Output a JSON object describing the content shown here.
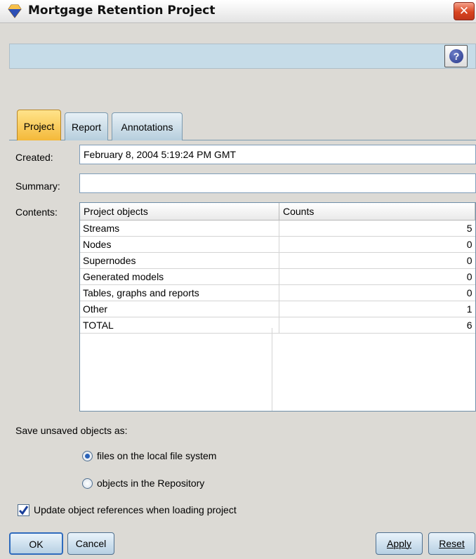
{
  "window": {
    "title": "Mortgage Retention Project",
    "close_glyph": "✕",
    "help_glyph": "?"
  },
  "tabs": [
    {
      "label": "Project",
      "active": true
    },
    {
      "label": "Report",
      "active": false
    },
    {
      "label": "Annotations",
      "active": false
    }
  ],
  "form": {
    "created_label": "Created:",
    "created_value": "February 8, 2004 5:19:24 PM GMT",
    "summary_label": "Summary:",
    "summary_value": "",
    "contents_label": "Contents:"
  },
  "table": {
    "columns": [
      "Project objects",
      "Counts"
    ],
    "rows": [
      [
        "Streams",
        "5"
      ],
      [
        "Nodes",
        "0"
      ],
      [
        "Supernodes",
        "0"
      ],
      [
        "Generated models",
        "0"
      ],
      [
        "Tables, graphs and reports",
        "0"
      ],
      [
        "Other",
        "1"
      ],
      [
        "TOTAL",
        "6"
      ]
    ]
  },
  "save": {
    "heading": "Save unsaved objects as:",
    "options": [
      {
        "label": "files on the local file system",
        "selected": true
      },
      {
        "label": "objects in the Repository",
        "selected": false
      }
    ]
  },
  "update_refs": {
    "label": "Update object references when loading project",
    "checked": true
  },
  "buttons": {
    "ok": "OK",
    "cancel": "Cancel",
    "apply": "Apply",
    "reset": "Reset"
  },
  "icons": {
    "app": "diamond-app-icon",
    "close": "close-icon",
    "help": "help-icon"
  },
  "colors": {
    "active_tab": "#f4b93a",
    "toolbar": "#c6dce8",
    "close": "#d9441f"
  }
}
